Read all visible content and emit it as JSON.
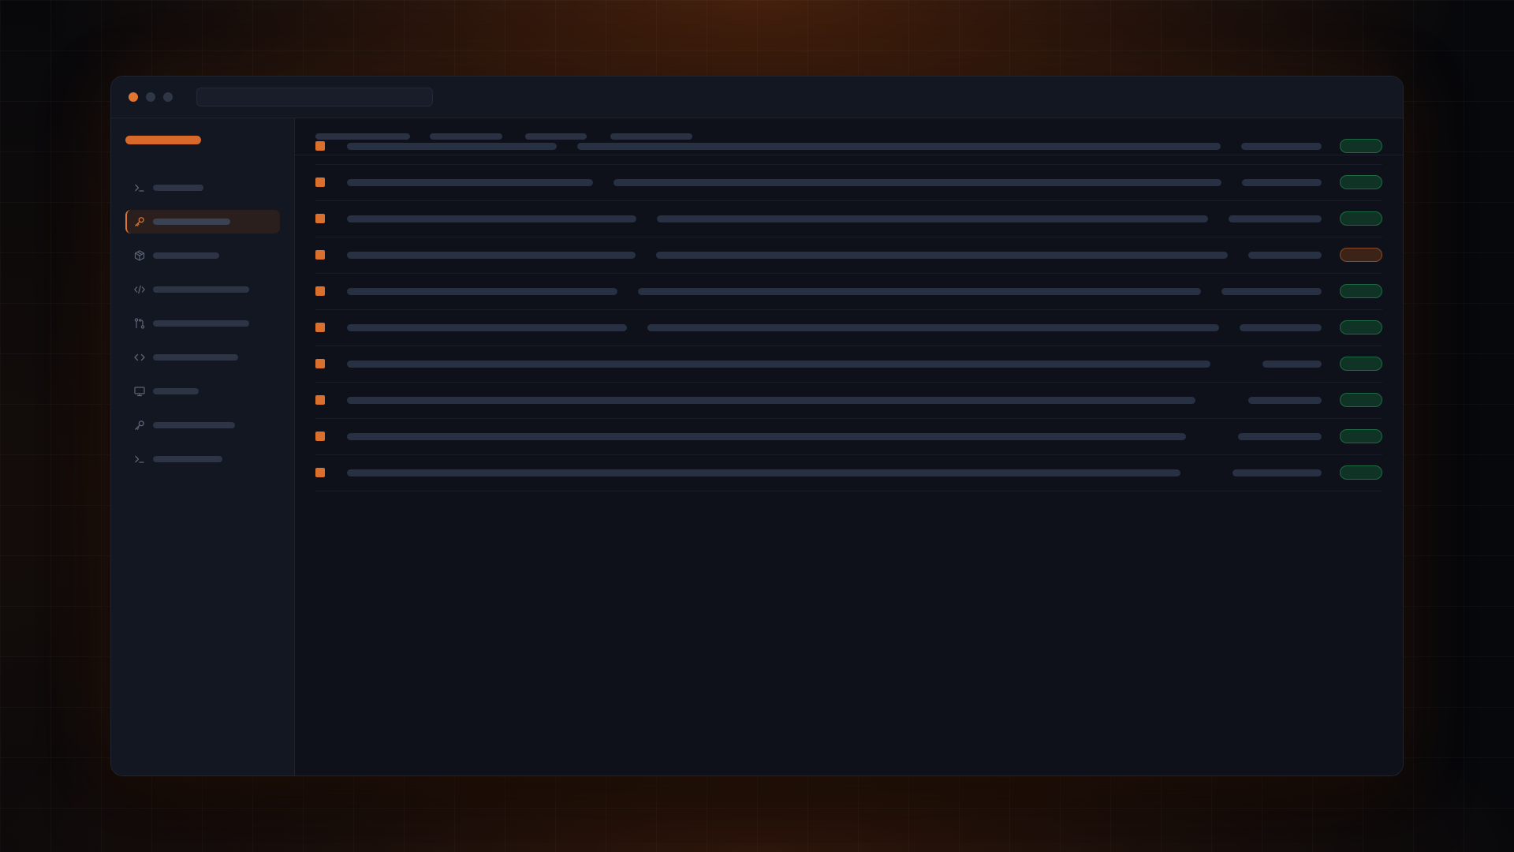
{
  "window": {
    "traffic_lights": [
      {
        "name": "close-dot",
        "color": "#e0762f"
      },
      {
        "name": "minimize-dot",
        "color": "#2f3645"
      },
      {
        "name": "maximize-dot",
        "color": "#2f3645"
      }
    ],
    "address_bar": {
      "value": ""
    }
  },
  "theme": {
    "accent": "#e0762f",
    "success": "#1e6b43",
    "warning": "#8a4a26"
  },
  "sidebar": {
    "brand": "",
    "active_index": 1,
    "items": [
      {
        "icon": "terminal-icon",
        "label": ""
      },
      {
        "icon": "key-icon",
        "label": ""
      },
      {
        "icon": "package-icon",
        "label": ""
      },
      {
        "icon": "code-icon",
        "label": ""
      },
      {
        "icon": "git-compare-icon",
        "label": ""
      },
      {
        "icon": "code-brackets-icon",
        "label": ""
      },
      {
        "icon": "monitor-icon",
        "label": ""
      },
      {
        "icon": "key-icon",
        "label": ""
      },
      {
        "icon": "terminal-icon",
        "label": ""
      }
    ]
  },
  "toolbar": {
    "tabs": [
      {
        "label": ""
      },
      {
        "label": ""
      },
      {
        "label": ""
      },
      {
        "label": ""
      }
    ]
  },
  "list": {
    "rows": [
      {
        "title": "",
        "description": "",
        "meta": "",
        "status": "ok"
      },
      {
        "title": "",
        "description": "",
        "meta": "",
        "status": "ok"
      },
      {
        "title": "",
        "description": "",
        "meta": "",
        "status": "ok"
      },
      {
        "title": "",
        "description": "",
        "meta": "",
        "status": "warn"
      },
      {
        "title": "",
        "description": "",
        "meta": "",
        "status": "ok"
      },
      {
        "title": "",
        "description": "",
        "meta": "",
        "status": "ok"
      },
      {
        "title": "",
        "description": "",
        "meta": "",
        "status": "ok"
      },
      {
        "title": "",
        "description": "",
        "meta": "",
        "status": "ok"
      },
      {
        "title": "",
        "description": "",
        "meta": "",
        "status": "ok"
      },
      {
        "title": "",
        "description": "",
        "meta": "",
        "status": "ok"
      }
    ]
  }
}
